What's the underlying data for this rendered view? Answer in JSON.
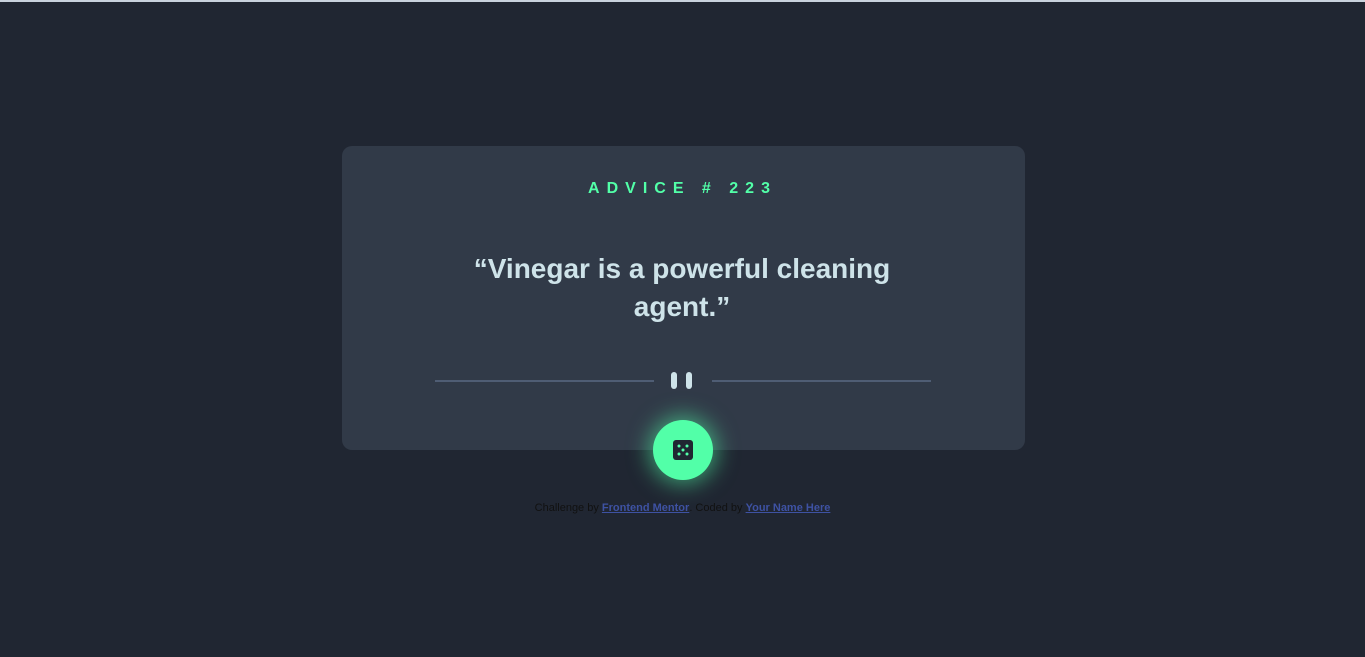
{
  "advice": {
    "id_label": "ADVICE # 223",
    "text": "“Vinegar is a powerful cleaning agent.”"
  },
  "icons": {
    "divider": "pause-icon",
    "button": "dice-icon"
  },
  "attribution": {
    "challenge_prefix": "Challenge by ",
    "challenge_link": "Frontend Mentor",
    "separator": ". Coded by ",
    "coder_link": "Your Name Here"
  },
  "colors": {
    "background": "#202632",
    "card": "#313a48",
    "accent": "#52ffa8",
    "text": "#cee3e9",
    "link": "#3e52a3"
  }
}
